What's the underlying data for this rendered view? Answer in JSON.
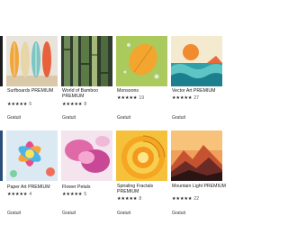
{
  "tiles": [
    {
      "title": "Surfboards PREMIUM",
      "stars": "★★★★★",
      "count": "5",
      "price": "Gratuit"
    },
    {
      "title": "World of Bamboo PREMIUM",
      "stars": "★★★★★",
      "count": "8",
      "price": "Gratuit"
    },
    {
      "title": "Monsoons",
      "stars": "★★★★★",
      "count": "19",
      "price": "Gratuit"
    },
    {
      "title": "Vector Art PREMIUM",
      "stars": "★★★★★",
      "count": "27",
      "price": "Gratuit"
    },
    {
      "title": "Paper Art PREMIUM",
      "stars": "★★★★★",
      "count": "4",
      "price": "Gratuit"
    },
    {
      "title": "Flower Petals",
      "stars": "★★★★★",
      "count": "5",
      "price": "Gratuit"
    },
    {
      "title": "Spiraling Fractals PREMIUM",
      "stars": "★★★★★",
      "count": "8",
      "price": "Gratuit"
    },
    {
      "title": "Mountain Light PREMIUM",
      "stars": "★★★★★",
      "count": "22",
      "price": "Gratuit"
    }
  ]
}
